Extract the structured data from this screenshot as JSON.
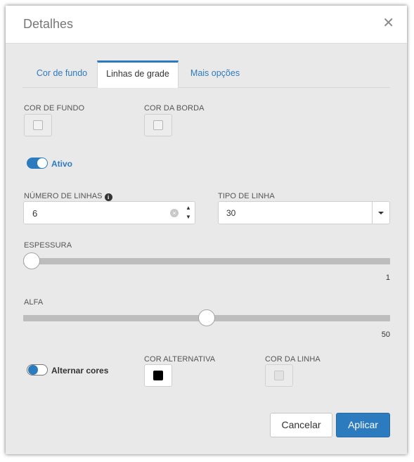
{
  "dialog": {
    "title": "Detalhes",
    "close_icon": "close-icon",
    "close_glyph": "✕"
  },
  "tabs": [
    {
      "label": "Cor de fundo",
      "active": false
    },
    {
      "label": "Linhas de grade",
      "active": true
    },
    {
      "label": "Mais opções",
      "active": false
    }
  ],
  "background_section": {
    "fill_color_label": "COR DE FUNDO",
    "border_color_label": "COR DA BORDA"
  },
  "active_toggle": {
    "label": "Ativo",
    "on": true
  },
  "line_count": {
    "label": "NÚMERO DE LINHAS",
    "info_glyph": "i",
    "value": "6",
    "clear_glyph": "×",
    "up_glyph": "▲",
    "down_glyph": "▼"
  },
  "line_type": {
    "label": "TIPO DE LINHA",
    "value": "30"
  },
  "thickness": {
    "label": "ESPESSURA",
    "value": "1",
    "position_fraction": 0
  },
  "alpha": {
    "label": "ALFA",
    "value": "50",
    "position_fraction": 0.5
  },
  "alternate": {
    "toggle_label": "Alternar cores",
    "on": false,
    "alt_color_label": "COR ALTERNATIVA",
    "alt_color": "#000000",
    "line_color_label": "COR DA LINHA"
  },
  "buttons": {
    "cancel": "Cancelar",
    "apply": "Aplicar"
  },
  "colors": {
    "accent": "#2d7bbf",
    "dialog_bg": "#e9e9e9",
    "track": "#bdbdbd"
  }
}
